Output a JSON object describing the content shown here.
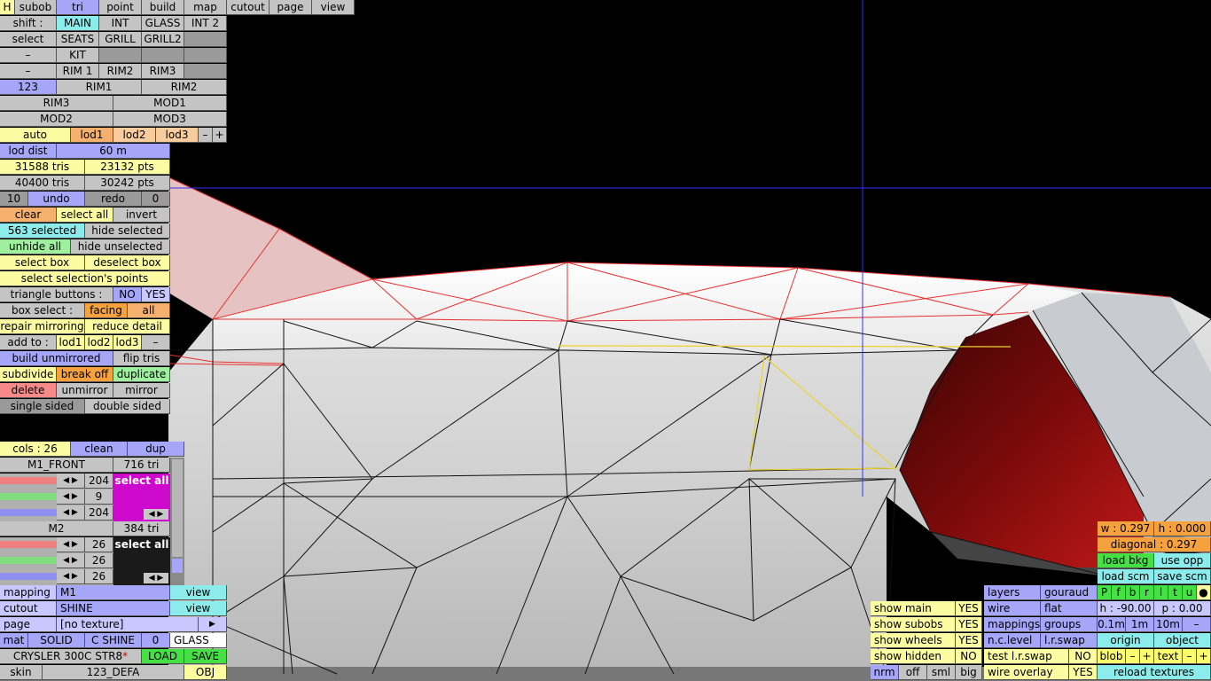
{
  "menu": {
    "h": "H",
    "subob": "subob",
    "tri": "tri",
    "point": "point",
    "build": "build",
    "map": "map",
    "cutout": "cutout",
    "page": "page",
    "view": "view"
  },
  "shift": {
    "label": "shift :",
    "main": "MAIN",
    "int": "INT",
    "glass": "GLASS",
    "int2": "INT 2",
    "select": "select",
    "seats": "SEATS",
    "grill": "GRILL",
    "grill2": "GRILL2",
    "dash1": "–",
    "kit": "KIT",
    "dash2": "–",
    "rim1": "RIM 1",
    "rim2": "RIM2",
    "rim3": "RIM3"
  },
  "subob_row": {
    "n123": "123",
    "rim1": "RIM1",
    "rim2": "RIM2",
    "rim3": "RIM3",
    "mod1": "MOD1",
    "mod2": "MOD2",
    "mod3": "MOD3"
  },
  "lod": {
    "auto": "auto",
    "lod1": "lod1",
    "lod2": "lod2",
    "lod3": "lod3",
    "minus": "–",
    "plus": "+",
    "dist_label": "lod dist",
    "dist_value": "60 m"
  },
  "stats": {
    "tris1": "31588 tris",
    "pts1": "23132 pts",
    "tris2": "40400 tris",
    "pts2": "30242 pts"
  },
  "undo": {
    "count": "10",
    "undo": "undo",
    "redo": "redo",
    "redo_count": "0"
  },
  "selection": {
    "clear": "clear",
    "select_all": "select all",
    "invert": "invert",
    "selected": "563 selected",
    "hide_selected": "hide selected",
    "unhide_all": "unhide all",
    "hide_unselected": "hide unselected",
    "select_box": "select box",
    "deselect_box": "deselect box",
    "select_points": "select selection's points",
    "tri_buttons": "triangle buttons :",
    "no": "NO",
    "yes": "YES",
    "box_select": "box select :",
    "facing": "facing",
    "all": "all",
    "repair_mirroring": "repair mirroring",
    "reduce_detail": "reduce detail",
    "add_to": "add to :",
    "lod1": "lod1",
    "lod2": "lod2",
    "lod3": "lod3",
    "dash": "–",
    "build_unmirrored": "build unmirrored",
    "flip_tris": "flip tris",
    "subdivide": "subdivide",
    "break_off": "break off",
    "duplicate": "duplicate",
    "delete": "delete",
    "unmirror": "unmirror",
    "mirror": "mirror",
    "single_sided": "single sided",
    "double_sided": "double sided"
  },
  "cols": {
    "label": "cols : 26",
    "clean": "clean",
    "dup": "dup"
  },
  "materials": [
    {
      "name": "M1_FRONT",
      "tris": "716 tri",
      "r": "204",
      "g": "9",
      "b": "204",
      "select_all": "select all",
      "swatch": "#cc09cc"
    },
    {
      "name": "M2",
      "tris": "384 tri",
      "r": "26",
      "g": "26",
      "b": "26",
      "select_all": "select all",
      "swatch": "#1a1a1a"
    }
  ],
  "mapping": {
    "mapping_label": "mapping",
    "mapping_value": "M1",
    "view1": "view",
    "cutout_label": "cutout",
    "cutout_value": "SHINE",
    "view2": "view",
    "page_label": "page",
    "page_value": "[no texture]",
    "arrow": "▶",
    "mat": "mat",
    "solid": "SOLID",
    "cshine": "C SHINE",
    "zero": "0",
    "glass": "GLASS",
    "car_name": "CRYSLER 300C STR8",
    "asterisk": "*",
    "load": "LOAD",
    "save": "SAVE",
    "skin_label": "skin",
    "skin_value": "123_DEFA",
    "obj": "OBJ"
  },
  "right_panel": {
    "w": "w : 0.297",
    "h": "h : 0.000",
    "diagonal": "diagonal : 0.297",
    "load_bkg": "load bkg",
    "use_opp": "use opp",
    "load_scm": "load scm",
    "save_scm": "save scm",
    "letters": [
      "P",
      "f",
      "b",
      "r",
      "l",
      "t",
      "u",
      "●"
    ],
    "h_angle": "h : -90.00",
    "p_angle": "p : 0.00",
    "s01": "0.1m",
    "s1": "1m",
    "s10": "10m",
    "sdash": "–",
    "origin": "origin",
    "object": "object",
    "blob": "blob",
    "blob_minus": "–",
    "blob_plus": "+",
    "text": "text",
    "text_minus": "–",
    "text_plus": "+",
    "reload_textures": "reload textures"
  },
  "view_panel": {
    "show_main": "show main",
    "show_main_v": "YES",
    "show_subobs": "show subobs",
    "show_subobs_v": "YES",
    "show_wheels": "show wheels",
    "show_wheels_v": "YES",
    "show_hidden": "show hidden",
    "show_hidden_v": "NO",
    "nrm": "nrm",
    "off": "off",
    "sml": "sml",
    "big": "big",
    "layers": "layers",
    "gouraud": "gouraud",
    "wire": "wire",
    "flat": "flat",
    "mappings": "mappings",
    "groups": "groups",
    "nclevel": "n.c.level",
    "lrswap": "l.r.swap",
    "test_lrswap": "test l.r.swap",
    "test_v": "NO",
    "wire_overlay": "wire overlay",
    "wire_overlay_v": "YES"
  }
}
